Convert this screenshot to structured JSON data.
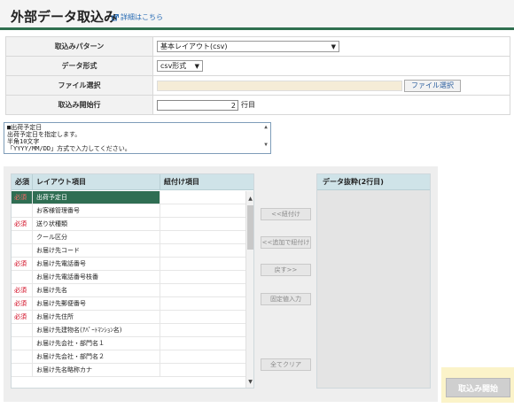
{
  "header": {
    "title": "外部データ取込み",
    "detail_link": "詳細はこちら"
  },
  "settings": {
    "pattern_label": "取込みパターン",
    "pattern_value": "基本レイアウト(csv)",
    "format_label": "データ形式",
    "format_value": "csv形式",
    "file_label": "ファイル選択",
    "file_button": "ファイル選択",
    "start_row_label": "取込み開始行",
    "start_row_value": "2",
    "start_row_unit": "行目"
  },
  "help": {
    "lines": [
      "■出荷予定日",
      "出荷予定日を指定します。",
      "半角10文字",
      "「YYYY/MM/DD」方式で入力してください。"
    ]
  },
  "layout": {
    "col_required": "必須",
    "col_item": "レイアウト項目",
    "col_link": "紐付け項目",
    "rows": [
      {
        "req": "必須",
        "item": "出荷予定日",
        "selected": true
      },
      {
        "req": "",
        "item": "お客様管理番号",
        "selected": false
      },
      {
        "req": "必須",
        "item": "送り状種類",
        "selected": false
      },
      {
        "req": "",
        "item": "クール区分",
        "selected": false
      },
      {
        "req": "",
        "item": "お届け先コード",
        "selected": false
      },
      {
        "req": "必須",
        "item": "お届け先電話番号",
        "selected": false
      },
      {
        "req": "",
        "item": "お届け先電話番号枝番",
        "selected": false
      },
      {
        "req": "必須",
        "item": "お届け先名",
        "selected": false
      },
      {
        "req": "必須",
        "item": "お届け先郵便番号",
        "selected": false
      },
      {
        "req": "必須",
        "item": "お届け先住所",
        "selected": false
      },
      {
        "req": "",
        "item": "お届け先建物名(ｱﾊﾟｰﾄﾏﾝｼｮﾝ名)",
        "selected": false
      },
      {
        "req": "",
        "item": "お届け先会社・部門名１",
        "selected": false
      },
      {
        "req": "",
        "item": "お届け先会社・部門名２",
        "selected": false
      },
      {
        "req": "",
        "item": "お届け先名略称カナ",
        "selected": false
      }
    ]
  },
  "actions": {
    "link": "<<紐付け",
    "add_link": "<<追加で紐付け",
    "back": "戻す>>",
    "fixed_value": "固定値入力",
    "clear_all": "全てクリア"
  },
  "data_panel": {
    "title": "データ抜粋(2行目)"
  },
  "start_button": "取込み開始"
}
